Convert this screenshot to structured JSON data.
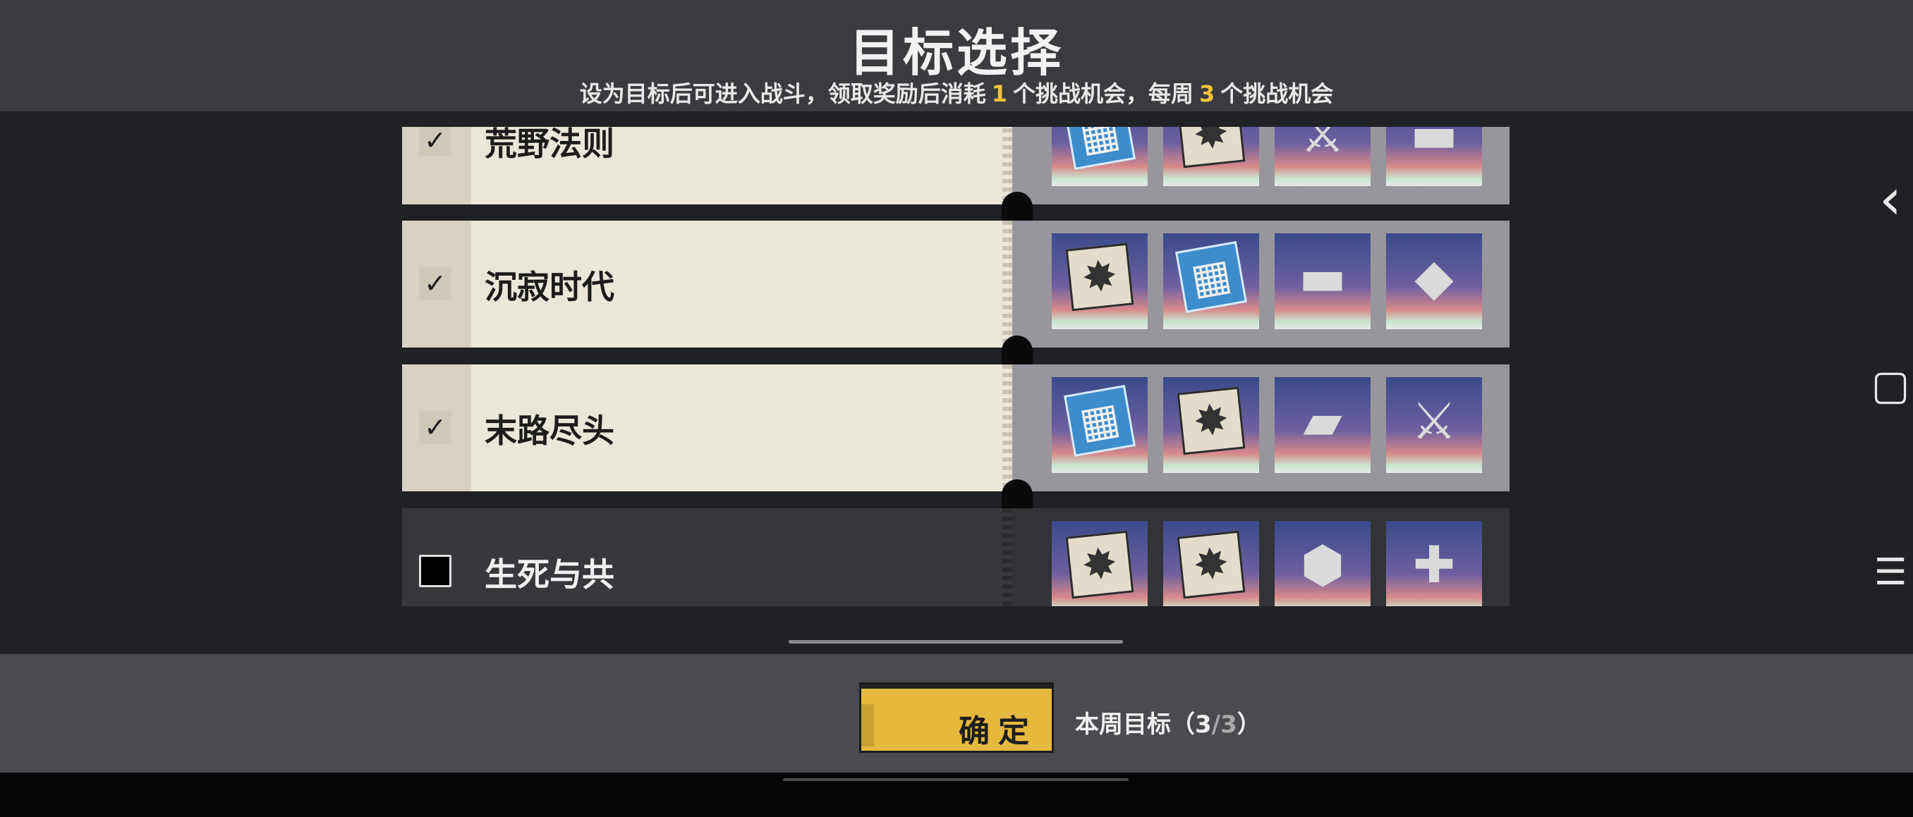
{
  "header": {
    "title": "目标选择",
    "subtitle_pre": "设为目标后可进入战斗，领取奖励后消耗",
    "subtitle_num1": "1",
    "subtitle_mid": "个挑战机会，每周",
    "subtitle_num2": "3",
    "subtitle_post": "个挑战机会"
  },
  "targets": [
    {
      "name": "荒野法则",
      "checked": true,
      "check_glyph": "✓",
      "items": [
        {
          "type": "blueprint",
          "icon": "blueprint-icon",
          "glyph": "▦"
        },
        {
          "type": "manual",
          "icon": "manual-icon",
          "glyph": "✸"
        },
        {
          "type": "weapon",
          "icon": "sword-icon",
          "glyph": "⚔"
        },
        {
          "type": "weapon",
          "icon": "rifle-icon",
          "glyph": "▬"
        }
      ]
    },
    {
      "name": "沉寂时代",
      "checked": true,
      "check_glyph": "✓",
      "items": [
        {
          "type": "manual",
          "icon": "manual-icon",
          "glyph": "✸"
        },
        {
          "type": "blueprint",
          "icon": "blueprint-icon",
          "glyph": "▦"
        },
        {
          "type": "weapon",
          "icon": "rifle-icon",
          "glyph": "▬"
        },
        {
          "type": "weapon",
          "icon": "blade-icon",
          "glyph": "◆"
        }
      ]
    },
    {
      "name": "末路尽头",
      "checked": true,
      "check_glyph": "✓",
      "items": [
        {
          "type": "blueprint",
          "icon": "blueprint-icon",
          "glyph": "▦"
        },
        {
          "type": "manual",
          "icon": "manual-icon",
          "glyph": "✸"
        },
        {
          "type": "weapon",
          "icon": "cannon-icon",
          "glyph": "▰"
        },
        {
          "type": "weapon",
          "icon": "sword-icon",
          "glyph": "⚔"
        }
      ]
    },
    {
      "name": "生死与共",
      "checked": false,
      "check_glyph": "",
      "items": [
        {
          "type": "manual",
          "icon": "manual-icon",
          "glyph": "✸"
        },
        {
          "type": "manual",
          "icon": "manual-icon",
          "glyph": "✸"
        },
        {
          "type": "weapon",
          "icon": "shield-icon",
          "glyph": "⬢"
        },
        {
          "type": "weapon",
          "icon": "launcher-icon",
          "glyph": "✚"
        }
      ]
    }
  ],
  "footer": {
    "confirm_label": "确定",
    "weekly_label": "本周目标（",
    "weekly_current": "3",
    "weekly_sep": "/",
    "weekly_total": "3",
    "weekly_close": "）"
  },
  "nav": {
    "back_glyph": "‹",
    "home_glyph": "▢",
    "menu_glyph": "☰"
  },
  "colors": {
    "accent": "#f3c23a",
    "confirm_button": "#e6b93e",
    "card_selected": "#ebe6da",
    "card_unselected": "#37383b"
  }
}
